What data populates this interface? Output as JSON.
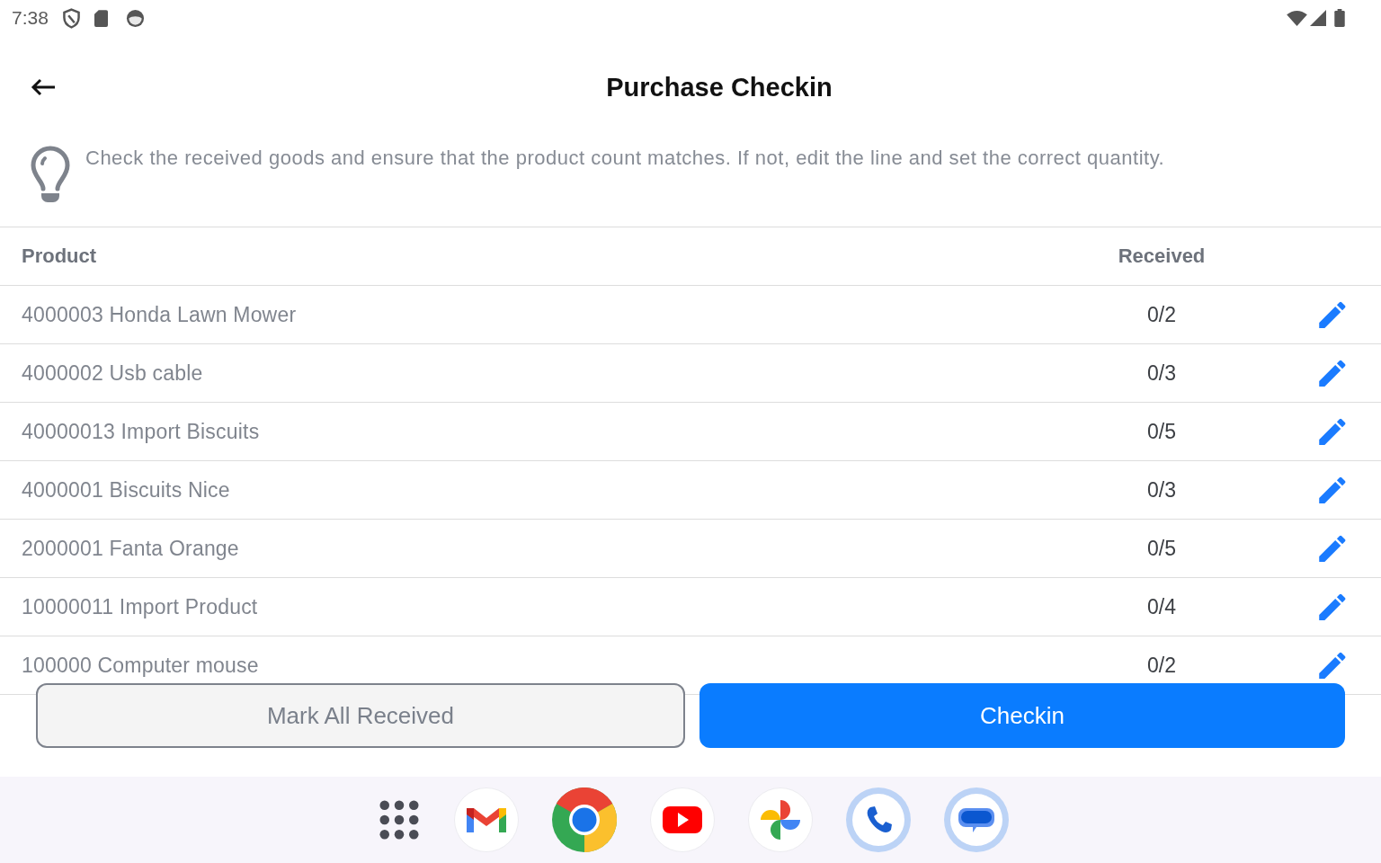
{
  "status_bar": {
    "time": "7:38"
  },
  "app_bar": {
    "title": "Purchase Checkin"
  },
  "hint": {
    "text": "Check the received goods and ensure that the product count matches. If not, edit the line and set the correct quantity."
  },
  "table": {
    "columns": [
      "Product",
      "Received"
    ],
    "rows": [
      {
        "product": "4000003 Honda Lawn Mower",
        "received": "0/2"
      },
      {
        "product": "4000002 Usb cable",
        "received": "0/3"
      },
      {
        "product": "40000013 Import Biscuits",
        "received": "0/5"
      },
      {
        "product": "4000001 Biscuits Nice",
        "received": "0/3"
      },
      {
        "product": "2000001 Fanta Orange",
        "received": "0/5"
      },
      {
        "product": "10000011 Import Product",
        "received": "0/4"
      },
      {
        "product": "100000 Computer mouse",
        "received": "0/2"
      }
    ]
  },
  "actions": [
    {
      "label": "Mark All Received",
      "kind": "secondary"
    },
    {
      "label": "Checkin",
      "kind": "primary"
    }
  ]
}
